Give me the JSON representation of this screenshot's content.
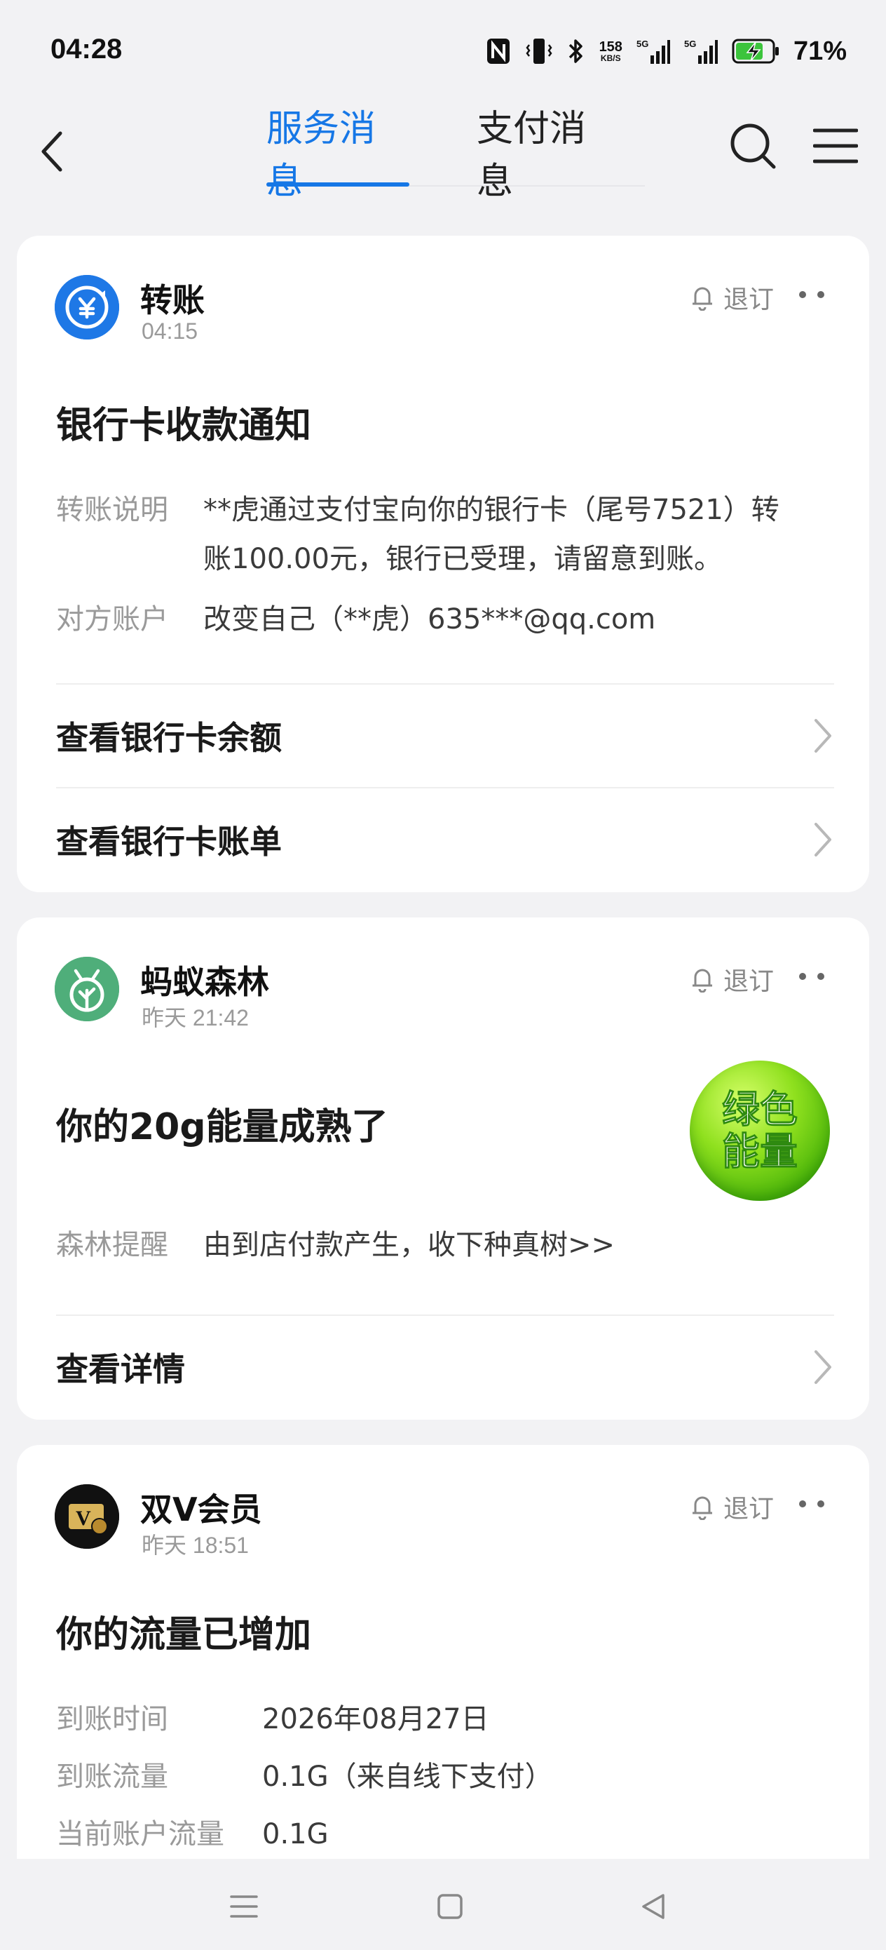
{
  "status_bar": {
    "time": "04:28",
    "net_speed_value": "158",
    "net_speed_unit": "KB/S",
    "battery_percent": "71%",
    "icons": [
      "nfc-icon",
      "vibrate-icon",
      "bluetooth-icon",
      "data-arrows-icon",
      "signal-5g-icon",
      "signal-5g-icon",
      "battery-charging-icon"
    ]
  },
  "header": {
    "tabs": [
      {
        "label": "服务消息",
        "active": true
      },
      {
        "label": "支付消息",
        "active": false
      }
    ],
    "accent_color": "#1677e6"
  },
  "cards": [
    {
      "service": "转账",
      "time": "04:15",
      "unsubscribe": "退订",
      "title": "银行卡收款通知",
      "rows": [
        {
          "key": "转账说明",
          "value_line1": "**虎通过支付宝向你的银行卡（尾号7521）转",
          "value_line2": "账100.00元，银行已受理，请留意到账。"
        },
        {
          "key": "对方账户",
          "value": "改变自己（**虎）635***@qq.com"
        }
      ],
      "actions": [
        "查看银行卡余额",
        "查看银行卡账单"
      ],
      "avatar_color": "#1e78e6"
    },
    {
      "service": "蚂蚁森林",
      "time": "昨天 21:42",
      "unsubscribe": "退订",
      "title": "你的20g能量成熟了",
      "badge_line1": "绿色",
      "badge_line2": "能量",
      "rows": [
        {
          "key": "森林提醒",
          "value": "由到店付款产生，收下种真树>>"
        }
      ],
      "actions": [
        "查看详情"
      ],
      "avatar_color": "#4fae7a"
    },
    {
      "service": "双V会员",
      "time": "昨天 18:51",
      "unsubscribe": "退订",
      "title": "你的流量已增加",
      "rows": [
        {
          "key": "到账时间",
          "value": "2026年08月27日"
        },
        {
          "key": "到账流量",
          "value": "0.1G（来自线下支付）"
        },
        {
          "key": "当前账户流量",
          "value": "0.1G"
        }
      ],
      "avatar_color": "#111111"
    }
  ],
  "nav_bar": {
    "icons": [
      "menu-lines-icon",
      "home-square-icon",
      "back-triangle-icon"
    ]
  }
}
